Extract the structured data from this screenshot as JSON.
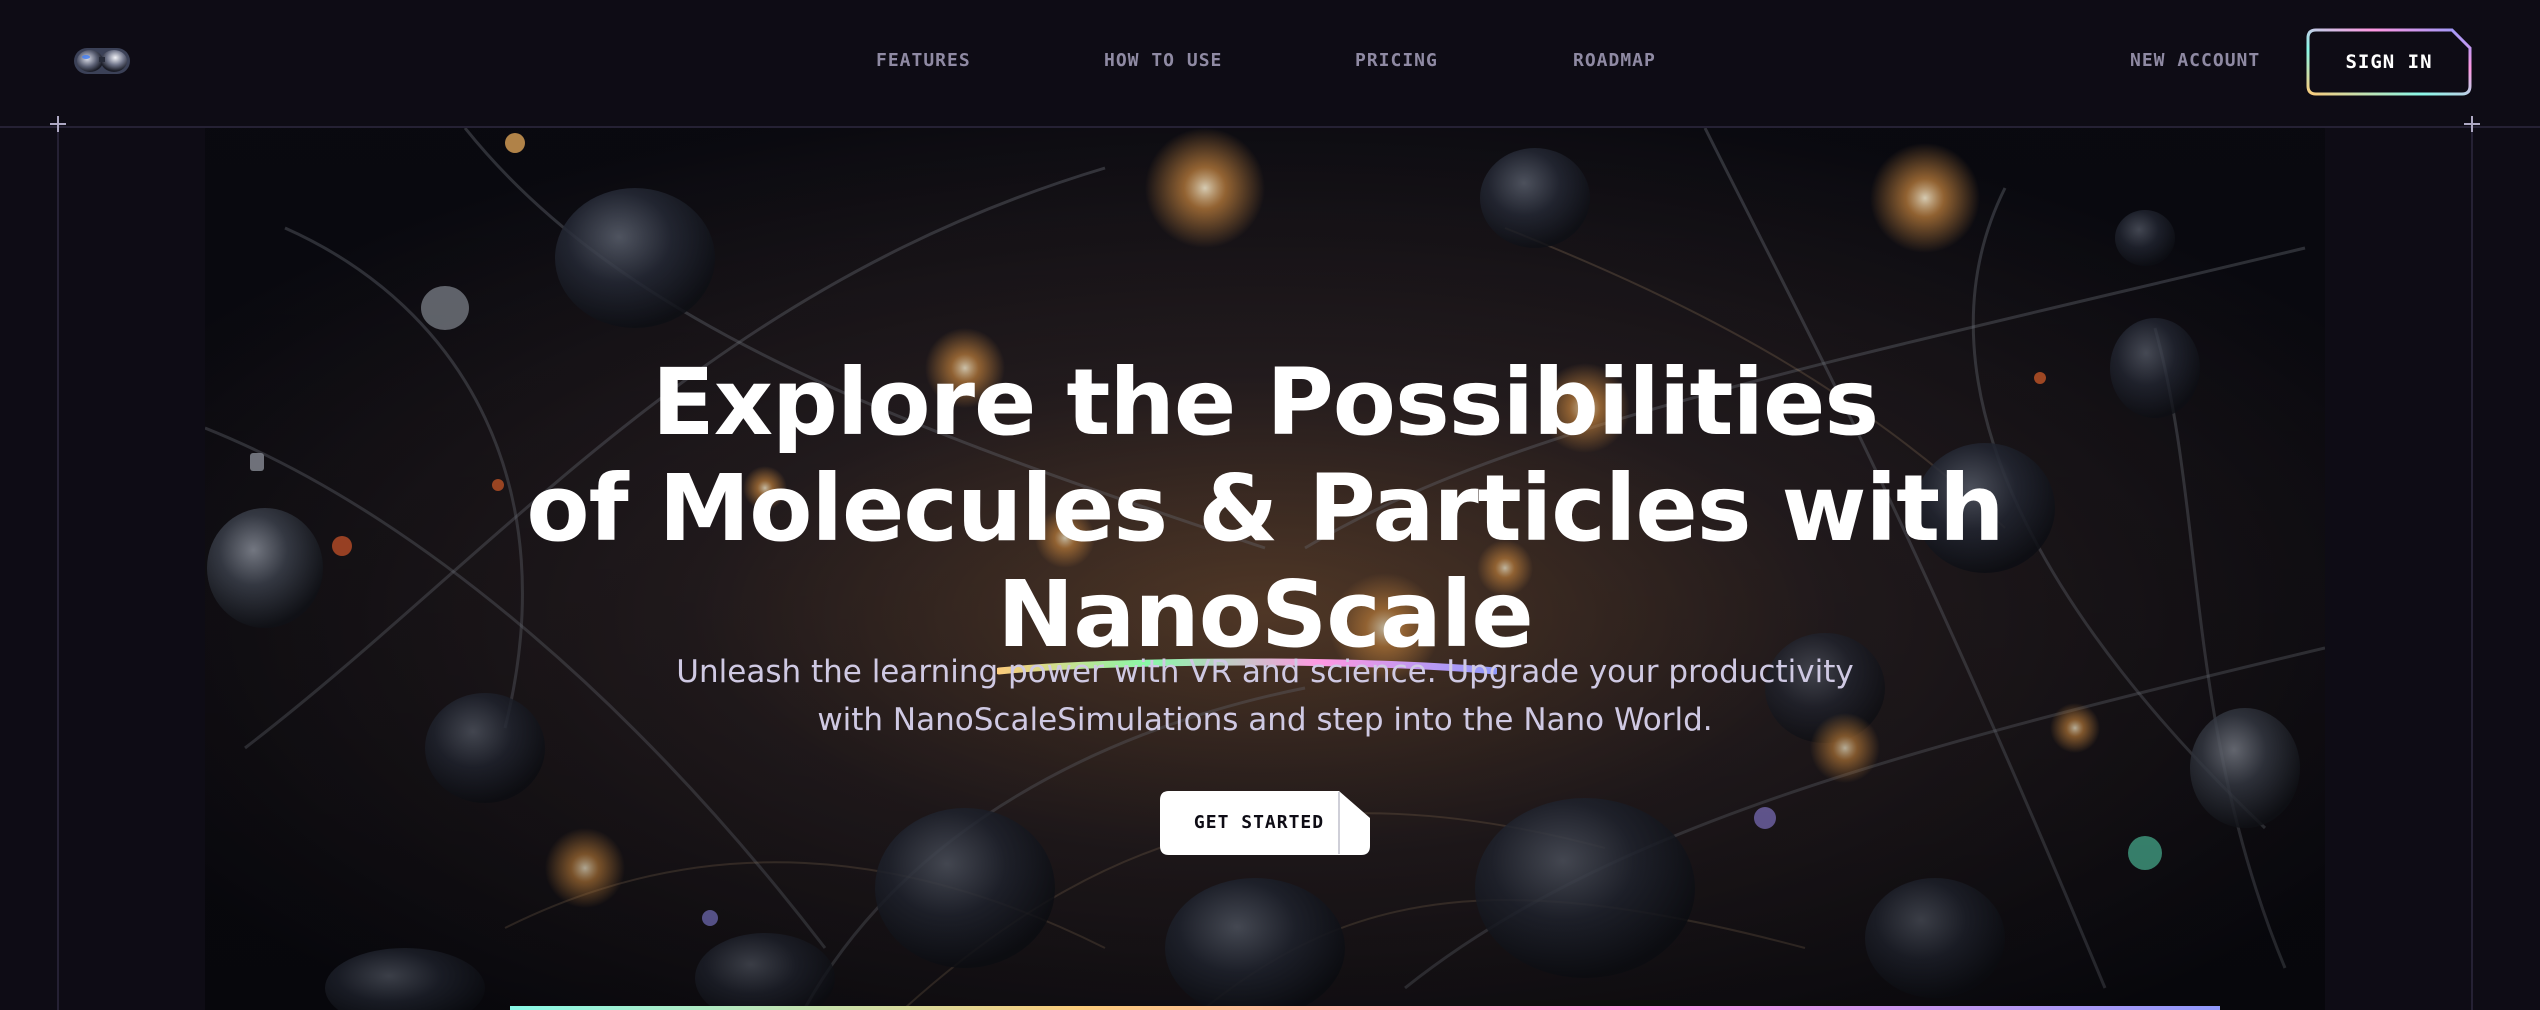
{
  "header": {
    "logo_icon": "vr-headset-icon",
    "nav": [
      {
        "label": "FEATURES"
      },
      {
        "label": "HOW TO USE"
      },
      {
        "label": "PRICING"
      },
      {
        "label": "ROADMAP"
      }
    ],
    "new_account_label": "NEW ACCOUNT",
    "sign_in_label": "SIGN IN"
  },
  "hero": {
    "title_line1": "Explore the Possibilities",
    "title_line2": "of Molecules & Particles with",
    "title_brand": "NanoScale",
    "subtitle_line1": "Unleash the learning power with VR and science. Upgrade your productivity",
    "subtitle_line2": "with NanoScaleSimulations and step into the Nano World.",
    "cta_label": "GET STARTED"
  },
  "colors": {
    "background": "#0e0c15",
    "nav_text": "#8f8aa3",
    "accent_gradient": [
      "#89f9e8",
      "#facb7b",
      "#ff98e2",
      "#9099fc"
    ]
  }
}
